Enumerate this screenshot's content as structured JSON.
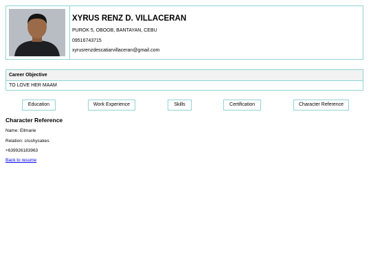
{
  "profile": {
    "name": "XYRUS RENZ D. VILLACERAN",
    "address": "PUROK 5, OBOOB, BANTAYAN, CEBU",
    "phone": "09516743715",
    "email": "xyrusrenzdescatiarvillaceran@gmail.com",
    "photo_alt": "profile photo"
  },
  "career": {
    "heading": "Career Objective",
    "value": "TO LOVE HER MAAM"
  },
  "tabs": [
    {
      "label": "Education"
    },
    {
      "label": "Work Experience"
    },
    {
      "label": "Skills"
    },
    {
      "label": "Certification"
    },
    {
      "label": "Character Reference"
    }
  ],
  "reference": {
    "title": "Character Reference",
    "name_line": "Name: Ellmarie",
    "relation_line": "Relation: crushycakes",
    "phone_line": "+639926183963"
  },
  "back_link": "Back to resume",
  "colors": {
    "border": "#8fd3d6",
    "link": "#0000ee"
  }
}
